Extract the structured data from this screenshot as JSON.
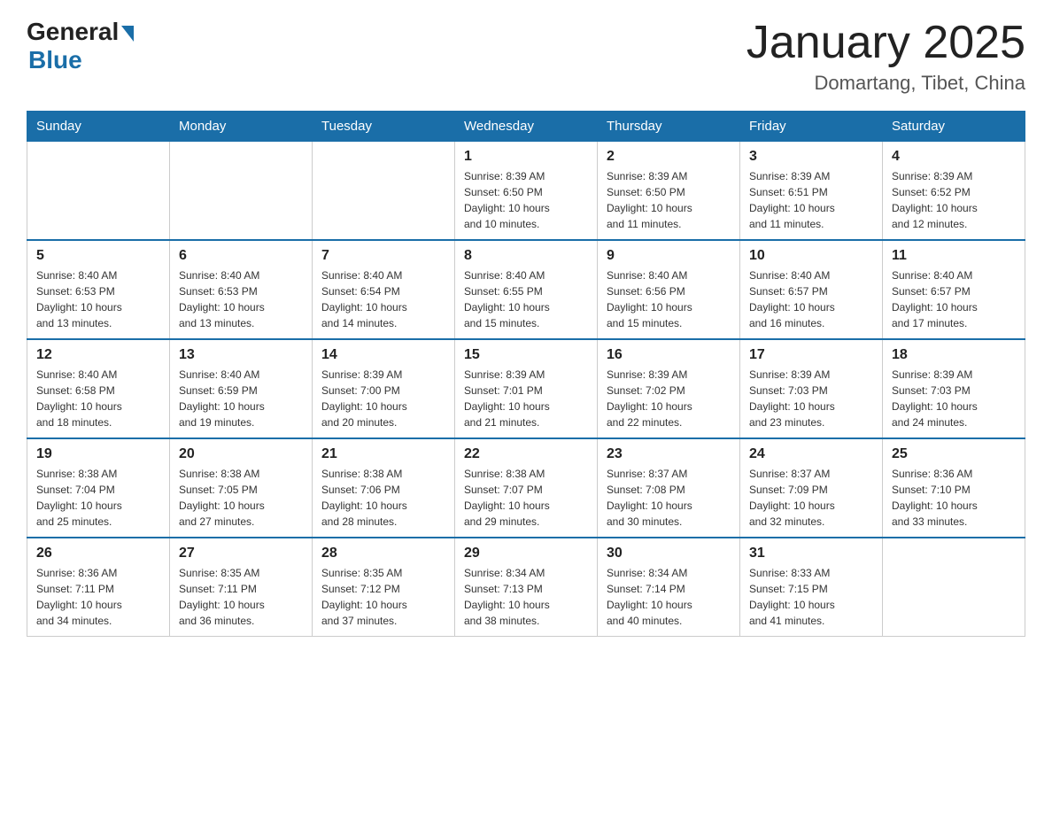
{
  "logo": {
    "general": "General",
    "blue": "Blue"
  },
  "title": "January 2025",
  "location": "Domartang, Tibet, China",
  "days_of_week": [
    "Sunday",
    "Monday",
    "Tuesday",
    "Wednesday",
    "Thursday",
    "Friday",
    "Saturday"
  ],
  "weeks": [
    [
      {
        "day": "",
        "info": ""
      },
      {
        "day": "",
        "info": ""
      },
      {
        "day": "",
        "info": ""
      },
      {
        "day": "1",
        "info": "Sunrise: 8:39 AM\nSunset: 6:50 PM\nDaylight: 10 hours\nand 10 minutes."
      },
      {
        "day": "2",
        "info": "Sunrise: 8:39 AM\nSunset: 6:50 PM\nDaylight: 10 hours\nand 11 minutes."
      },
      {
        "day": "3",
        "info": "Sunrise: 8:39 AM\nSunset: 6:51 PM\nDaylight: 10 hours\nand 11 minutes."
      },
      {
        "day": "4",
        "info": "Sunrise: 8:39 AM\nSunset: 6:52 PM\nDaylight: 10 hours\nand 12 minutes."
      }
    ],
    [
      {
        "day": "5",
        "info": "Sunrise: 8:40 AM\nSunset: 6:53 PM\nDaylight: 10 hours\nand 13 minutes."
      },
      {
        "day": "6",
        "info": "Sunrise: 8:40 AM\nSunset: 6:53 PM\nDaylight: 10 hours\nand 13 minutes."
      },
      {
        "day": "7",
        "info": "Sunrise: 8:40 AM\nSunset: 6:54 PM\nDaylight: 10 hours\nand 14 minutes."
      },
      {
        "day": "8",
        "info": "Sunrise: 8:40 AM\nSunset: 6:55 PM\nDaylight: 10 hours\nand 15 minutes."
      },
      {
        "day": "9",
        "info": "Sunrise: 8:40 AM\nSunset: 6:56 PM\nDaylight: 10 hours\nand 15 minutes."
      },
      {
        "day": "10",
        "info": "Sunrise: 8:40 AM\nSunset: 6:57 PM\nDaylight: 10 hours\nand 16 minutes."
      },
      {
        "day": "11",
        "info": "Sunrise: 8:40 AM\nSunset: 6:57 PM\nDaylight: 10 hours\nand 17 minutes."
      }
    ],
    [
      {
        "day": "12",
        "info": "Sunrise: 8:40 AM\nSunset: 6:58 PM\nDaylight: 10 hours\nand 18 minutes."
      },
      {
        "day": "13",
        "info": "Sunrise: 8:40 AM\nSunset: 6:59 PM\nDaylight: 10 hours\nand 19 minutes."
      },
      {
        "day": "14",
        "info": "Sunrise: 8:39 AM\nSunset: 7:00 PM\nDaylight: 10 hours\nand 20 minutes."
      },
      {
        "day": "15",
        "info": "Sunrise: 8:39 AM\nSunset: 7:01 PM\nDaylight: 10 hours\nand 21 minutes."
      },
      {
        "day": "16",
        "info": "Sunrise: 8:39 AM\nSunset: 7:02 PM\nDaylight: 10 hours\nand 22 minutes."
      },
      {
        "day": "17",
        "info": "Sunrise: 8:39 AM\nSunset: 7:03 PM\nDaylight: 10 hours\nand 23 minutes."
      },
      {
        "day": "18",
        "info": "Sunrise: 8:39 AM\nSunset: 7:03 PM\nDaylight: 10 hours\nand 24 minutes."
      }
    ],
    [
      {
        "day": "19",
        "info": "Sunrise: 8:38 AM\nSunset: 7:04 PM\nDaylight: 10 hours\nand 25 minutes."
      },
      {
        "day": "20",
        "info": "Sunrise: 8:38 AM\nSunset: 7:05 PM\nDaylight: 10 hours\nand 27 minutes."
      },
      {
        "day": "21",
        "info": "Sunrise: 8:38 AM\nSunset: 7:06 PM\nDaylight: 10 hours\nand 28 minutes."
      },
      {
        "day": "22",
        "info": "Sunrise: 8:38 AM\nSunset: 7:07 PM\nDaylight: 10 hours\nand 29 minutes."
      },
      {
        "day": "23",
        "info": "Sunrise: 8:37 AM\nSunset: 7:08 PM\nDaylight: 10 hours\nand 30 minutes."
      },
      {
        "day": "24",
        "info": "Sunrise: 8:37 AM\nSunset: 7:09 PM\nDaylight: 10 hours\nand 32 minutes."
      },
      {
        "day": "25",
        "info": "Sunrise: 8:36 AM\nSunset: 7:10 PM\nDaylight: 10 hours\nand 33 minutes."
      }
    ],
    [
      {
        "day": "26",
        "info": "Sunrise: 8:36 AM\nSunset: 7:11 PM\nDaylight: 10 hours\nand 34 minutes."
      },
      {
        "day": "27",
        "info": "Sunrise: 8:35 AM\nSunset: 7:11 PM\nDaylight: 10 hours\nand 36 minutes."
      },
      {
        "day": "28",
        "info": "Sunrise: 8:35 AM\nSunset: 7:12 PM\nDaylight: 10 hours\nand 37 minutes."
      },
      {
        "day": "29",
        "info": "Sunrise: 8:34 AM\nSunset: 7:13 PM\nDaylight: 10 hours\nand 38 minutes."
      },
      {
        "day": "30",
        "info": "Sunrise: 8:34 AM\nSunset: 7:14 PM\nDaylight: 10 hours\nand 40 minutes."
      },
      {
        "day": "31",
        "info": "Sunrise: 8:33 AM\nSunset: 7:15 PM\nDaylight: 10 hours\nand 41 minutes."
      },
      {
        "day": "",
        "info": ""
      }
    ]
  ]
}
